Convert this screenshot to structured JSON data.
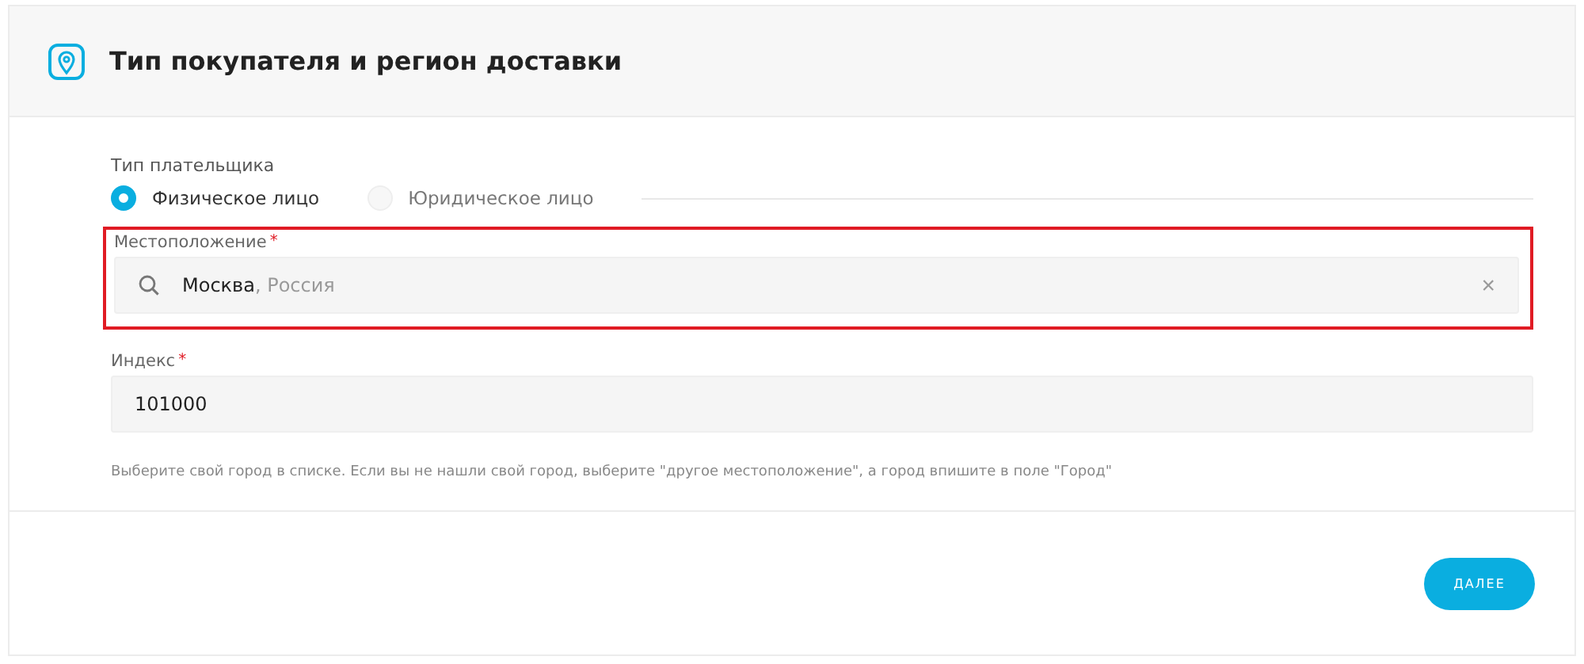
{
  "header": {
    "title": "Тип покупателя и регион доставки"
  },
  "payer_type": {
    "label": "Тип плательщика",
    "options": [
      {
        "label": "Физическое лицо",
        "selected": true
      },
      {
        "label": "Юридическое лицо",
        "selected": false
      }
    ]
  },
  "location": {
    "label": "Местоположение",
    "required_mark": "*",
    "highlighted": true,
    "city": "Москва",
    "country": ", Россия",
    "clear": "×"
  },
  "index": {
    "label": "Индекс",
    "required_mark": "*",
    "value": "101000"
  },
  "hint": "Выберите свой город в списке. Если вы не нашли свой город, выберите \"другое местоположение\", а город впишите в поле \"Город\"",
  "next_button": "ДАЛЕЕ"
}
